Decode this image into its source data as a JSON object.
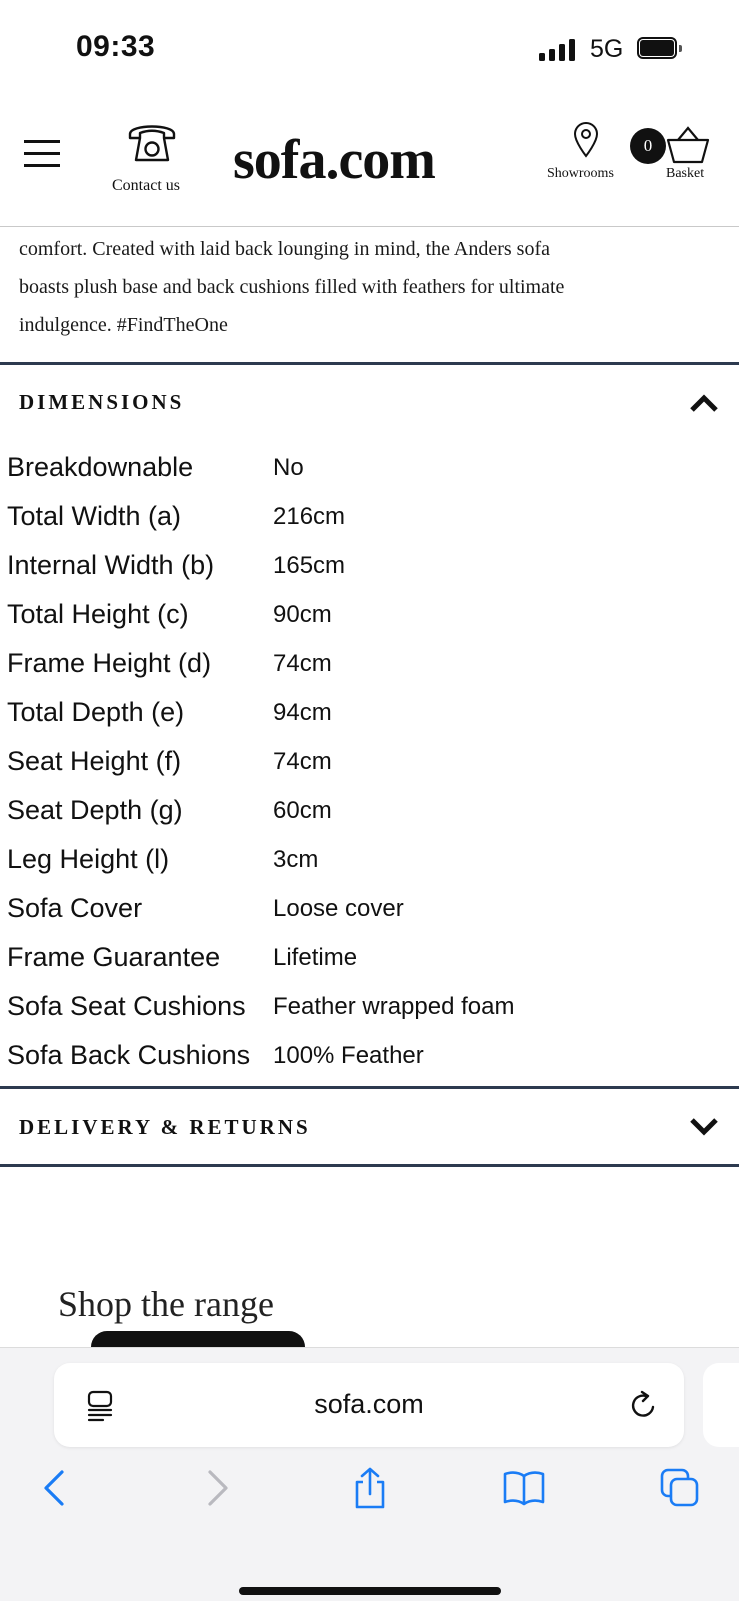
{
  "status_bar": {
    "time": "09:33",
    "network": "5G"
  },
  "header": {
    "contact_label": "Contact us",
    "logo": "sofa.com",
    "showrooms_label": "Showrooms",
    "basket_count": "0",
    "basket_label": "Basket"
  },
  "description": {
    "lines": [
      "comfort. Created with laid back lounging in mind, the Anders sofa",
      "boasts plush base and back cushions filled with feathers for ultimate",
      "indulgence. #FindTheOne"
    ]
  },
  "dimensions": {
    "title": "DIMENSIONS",
    "expanded": true,
    "rows": [
      {
        "label": "Breakdownable",
        "value": "No"
      },
      {
        "label": "Total Width (a)",
        "value": "216cm"
      },
      {
        "label": "Internal Width (b)",
        "value": "165cm"
      },
      {
        "label": "Total Height (c)",
        "value": "90cm"
      },
      {
        "label": "Frame Height (d)",
        "value": "74cm"
      },
      {
        "label": "Total Depth (e)",
        "value": "94cm"
      },
      {
        "label": "Seat Height (f)",
        "value": "74cm"
      },
      {
        "label": "Seat Depth (g)",
        "value": "60cm"
      },
      {
        "label": "Leg Height (l)",
        "value": "3cm"
      },
      {
        "label": "Sofa Cover",
        "value": "Loose cover"
      },
      {
        "label": "Frame Guarantee",
        "value": "Lifetime"
      },
      {
        "label": "Sofa Seat Cushions",
        "value": "Feather wrapped foam"
      },
      {
        "label": "Sofa Back Cushions",
        "value": "100% Feather"
      }
    ]
  },
  "delivery": {
    "title": "DELIVERY & RETURNS",
    "expanded": false
  },
  "shop": {
    "title": "Shop the range"
  },
  "browser": {
    "url": "sofa.com"
  },
  "colors": {
    "rule": "#2d3a4f",
    "safari_blue": "#1a7cf5"
  },
  "icons": [
    "menu-icon",
    "telephone-icon",
    "location-pin-icon",
    "basket-icon",
    "chevron-up-icon",
    "chevron-down-icon",
    "reader-icon",
    "reload-icon",
    "back-icon",
    "forward-icon",
    "share-icon",
    "bookmarks-icon",
    "tabs-icon"
  ]
}
